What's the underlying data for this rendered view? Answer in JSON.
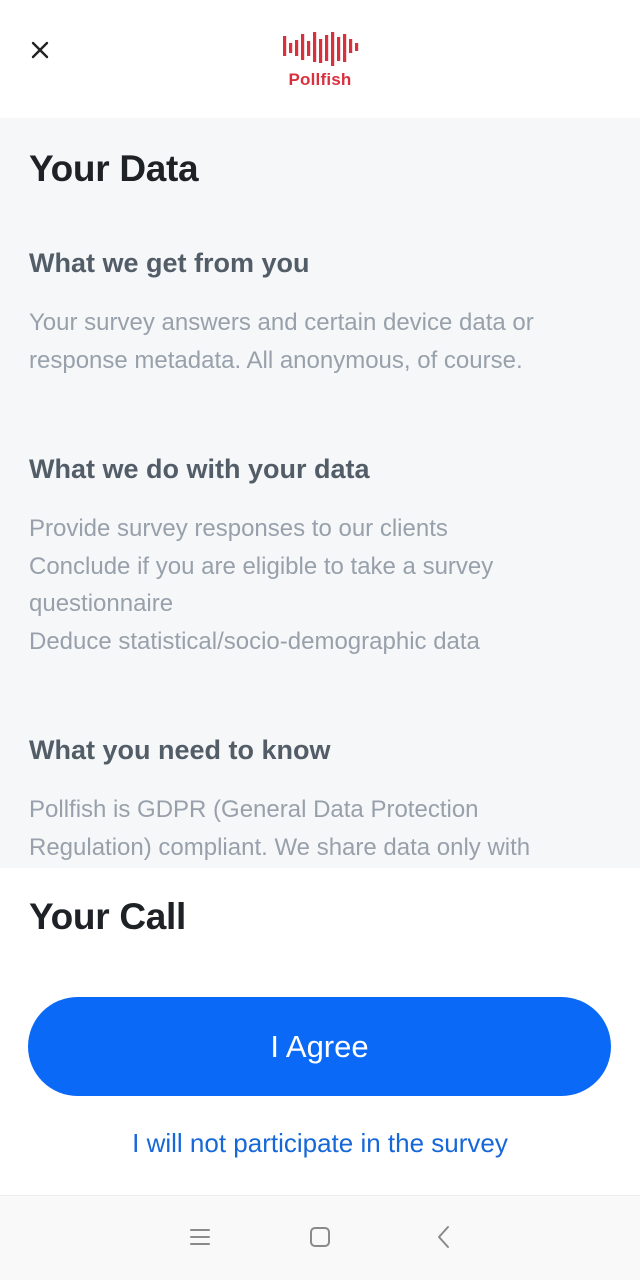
{
  "header": {
    "close_icon": "close-icon",
    "logo_text": "Pollfish",
    "brand_color": "#d9303e"
  },
  "content": {
    "title": "Your Data",
    "sections": [
      {
        "heading": "What we get from you",
        "lines": [
          "Your survey answers and certain device data or",
          "response metadata. All anonymous, of course."
        ]
      },
      {
        "heading": "What we do with your data",
        "lines": [
          "Provide survey responses to our clients",
          "Conclude if you are eligible to take a survey",
          "questionnaire",
          "Deduce statistical/socio-demographic data"
        ]
      },
      {
        "heading": "What you need to know",
        "lines": [
          "Pollfish is GDPR (General Data Protection",
          "Regulation) compliant. We share data only with"
        ]
      }
    ]
  },
  "call": {
    "title": "Your Call",
    "agree_label": "I Agree",
    "decline_label": "I will not participate in the survey",
    "accent_color": "#0b69f7"
  },
  "nav": {
    "icons": [
      "menu-icon",
      "home-icon",
      "back-icon"
    ]
  }
}
